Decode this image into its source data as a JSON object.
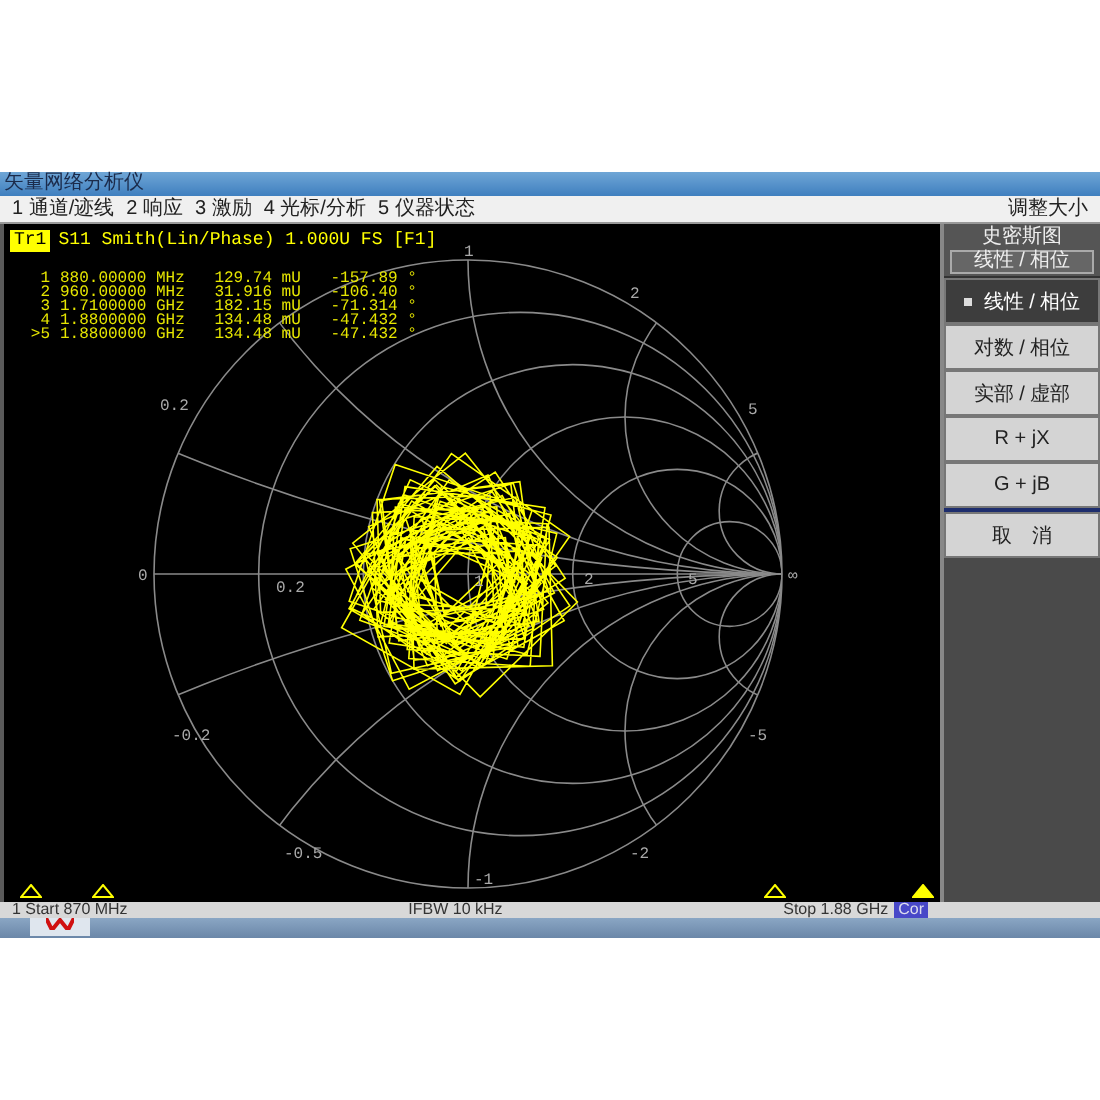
{
  "window": {
    "title": "矢量网络分析仪"
  },
  "menu": {
    "items": [
      "1 通道/迹线",
      "2 响应",
      "3 激励",
      "4 光标/分析",
      "5 仪器状态"
    ],
    "right": "调整大小"
  },
  "trace": {
    "badge": "Tr1",
    "selected": true,
    "title": "S11 Smith(Lin/Phase) 1.000U FS [F1]"
  },
  "markers": [
    {
      "index": "1",
      "frequency": "880.00000 MHz",
      "magnitude": "129.74 mU",
      "phase": "-157.89 °"
    },
    {
      "index": "2",
      "frequency": "960.00000 MHz",
      "magnitude": "31.916 mU",
      "phase": "-106.40 °"
    },
    {
      "index": "3",
      "frequency": "1.7100000 GHz",
      "magnitude": "182.15 mU",
      "phase": "-71.314 °"
    },
    {
      "index": "4",
      "frequency": "1.8800000 GHz",
      "magnitude": "134.48 mU",
      "phase": "-47.432 °"
    },
    {
      "index": ">5",
      "frequency": "1.8800000 GHz",
      "magnitude": "134.48 mU",
      "phase": "-47.432 °"
    }
  ],
  "smith": {
    "resistance_labels": [
      "0",
      "0.2",
      "1",
      "2",
      "5",
      "∞"
    ],
    "reactance_labels": [
      "0.2",
      "1",
      "2",
      "5",
      "-0.2",
      "-0.5",
      "-1",
      "-2",
      "-5"
    ]
  },
  "marker_flags": [
    {
      "selected": false
    },
    {
      "selected": false
    },
    {
      "selected": false
    },
    {
      "selected": true
    }
  ],
  "panel": {
    "title": "史密斯图",
    "subtitle": "线性 / 相位",
    "buttons": [
      {
        "label": "线性 / 相位",
        "selected": true
      },
      {
        "label": "对数 / 相位",
        "selected": false
      },
      {
        "label": "实部 / 虚部",
        "selected": false
      },
      {
        "label": "R + jX",
        "selected": false
      },
      {
        "label": "G + jB",
        "selected": false
      }
    ],
    "cancel": "取　消"
  },
  "status_bar": {
    "start": "1  Start 870 MHz",
    "ifbw": "IFBW 10 kHz",
    "stop": "Stop 1.88 GHz",
    "correction": "Cor"
  }
}
